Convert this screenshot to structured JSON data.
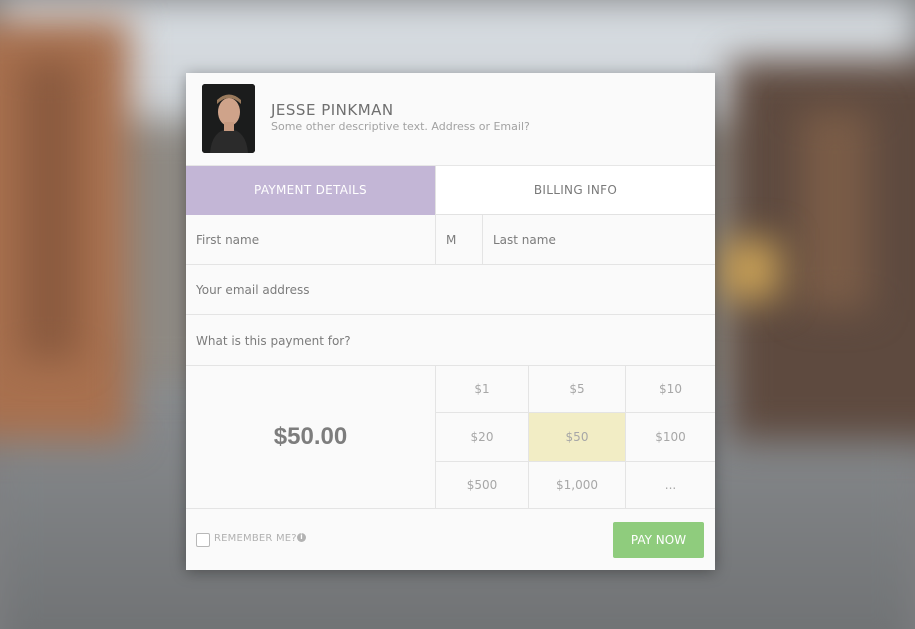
{
  "profile": {
    "name": "JESSE PINKMAN",
    "description": "Some other descriptive text. Address or Email?"
  },
  "tabs": [
    {
      "label": "PAYMENT DETAILS",
      "active": true
    },
    {
      "label": "BILLING INFO",
      "active": false
    }
  ],
  "form": {
    "first_name_placeholder": "First name",
    "middle_initial_placeholder": "M",
    "last_name_placeholder": "Last name",
    "email_placeholder": "Your email address",
    "purpose_placeholder": "What is this payment for?"
  },
  "amount": {
    "total": "$50.00",
    "options": [
      "$1",
      "$5",
      "$10",
      "$20",
      "$50",
      "$100",
      "$500",
      "$1,000",
      "..."
    ],
    "selected": "$50"
  },
  "footer": {
    "remember_label": "REMEMBER ME?",
    "info_icon": "i",
    "pay_label": "PAY NOW"
  },
  "colors": {
    "tab_active": "#c3b6d6",
    "selected_amount": "#f2edc5",
    "pay_button": "#8fcc7d"
  }
}
